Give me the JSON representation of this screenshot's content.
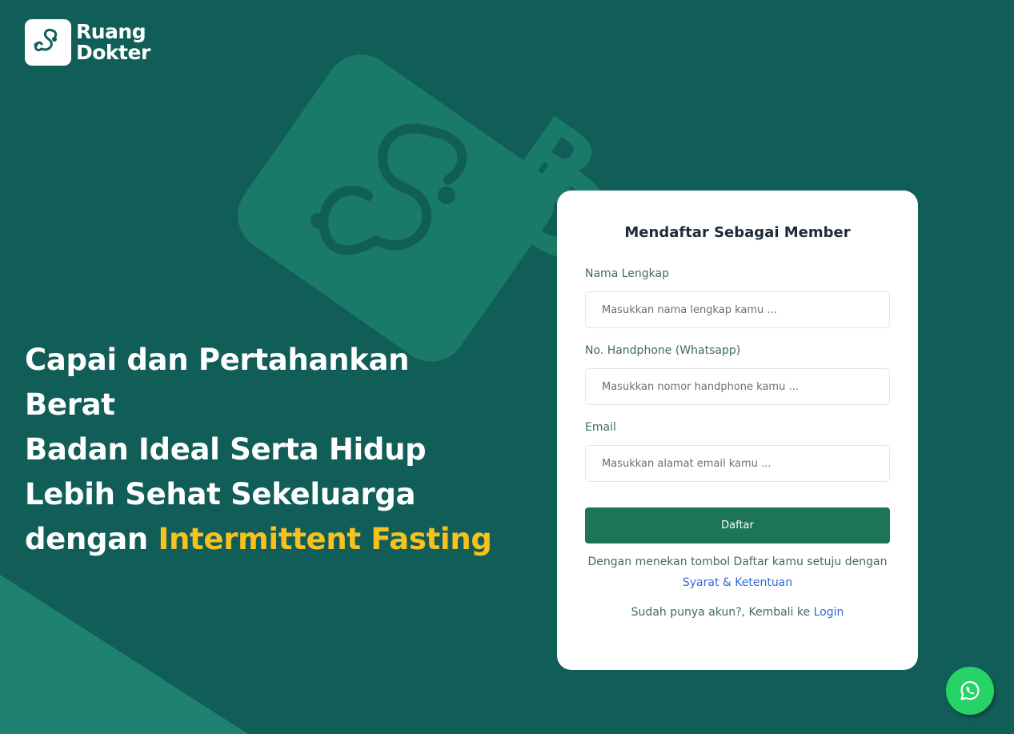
{
  "brand": {
    "line1": "Ruang",
    "line2": "Dokter"
  },
  "hero": {
    "line1": "Capai dan Pertahankan Berat",
    "line2": "Badan Ideal Serta Hidup",
    "line3": "Lebih Sehat Sekeluarga",
    "line4_prefix": "dengan ",
    "line4_accent": "Intermittent Fasting"
  },
  "form": {
    "title": "Mendaftar Sebagai Member",
    "name_label": "Nama Lengkap",
    "name_placeholder": "Masukkan nama lengkap kamu ...",
    "name_value": "",
    "phone_label": "No. Handphone (Whatsapp)",
    "phone_placeholder": "Masukkan nomor handphone kamu ...",
    "phone_value": "",
    "email_label": "Email",
    "email_placeholder": "Masukkan alamat email kamu ...",
    "email_value": "",
    "submit_label": "Daftar",
    "terms_text": "Dengan menekan tombol Daftar kamu setuju dengan",
    "terms_link": "Syarat & Ketentuan",
    "login_text": "Sudah punya akun?, Kembali ke ",
    "login_link": "Login"
  },
  "icons": {
    "logo": "stethoscope-icon",
    "whatsapp": "whatsapp-icon"
  },
  "colors": {
    "background": "#115e58",
    "accent": "#f7c21e",
    "button": "#1b7556",
    "link": "#3567d8",
    "whatsapp": "#25d366"
  }
}
